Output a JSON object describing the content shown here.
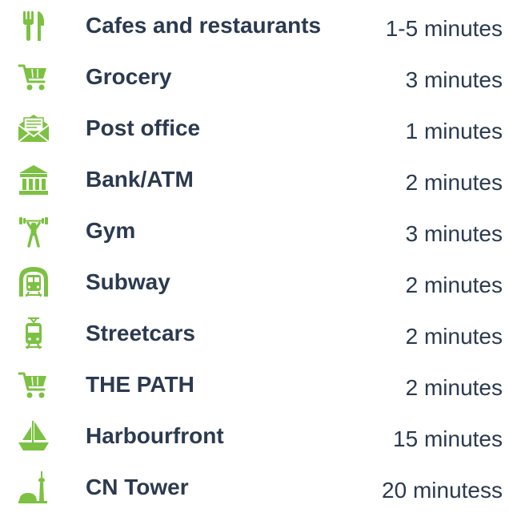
{
  "accent_color": "#7cc142",
  "text_color": "#2b3a4f",
  "items": [
    {
      "icon": "fork-knife-icon",
      "label": "Cafes and restaurants",
      "time": "1-5 minutes"
    },
    {
      "icon": "shopping-cart-icon",
      "label": "Grocery",
      "time": "3 minutes"
    },
    {
      "icon": "envelope-icon",
      "label": "Post office",
      "time": "1 minutes"
    },
    {
      "icon": "bank-icon",
      "label": "Bank/ATM",
      "time": "2 minutes"
    },
    {
      "icon": "weightlifter-icon",
      "label": "Gym",
      "time": "3 minutes"
    },
    {
      "icon": "subway-icon",
      "label": "Subway",
      "time": "2 minutes"
    },
    {
      "icon": "streetcar-icon",
      "label": "Streetcars",
      "time": "2 minutes"
    },
    {
      "icon": "shopping-cart-icon",
      "label": "THE PATH",
      "time": "2 minutes"
    },
    {
      "icon": "sailboat-icon",
      "label": "Harbourfront",
      "time": "15 minutes"
    },
    {
      "icon": "cn-tower-icon",
      "label": "CN Tower",
      "time": "20 minutess"
    }
  ]
}
